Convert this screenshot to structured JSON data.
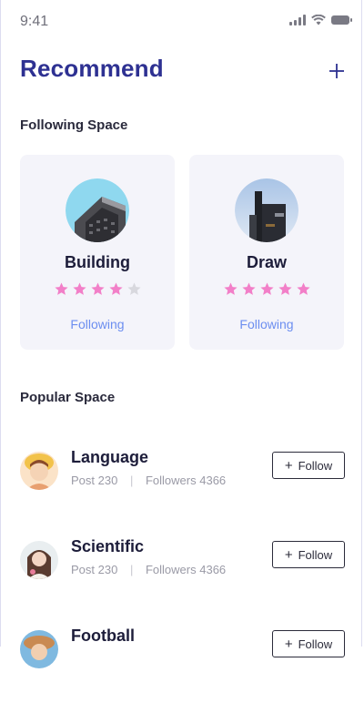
{
  "status_bar": {
    "time": "9:41",
    "icons": [
      "cellular-signal-icon",
      "wifi-icon",
      "battery-icon"
    ]
  },
  "header": {
    "title": "Recommend",
    "add_icon": "plus-icon"
  },
  "following_section": {
    "title": "Following Space",
    "cards": [
      {
        "name": "Building",
        "rating": 4,
        "max_rating": 5,
        "action": "Following"
      },
      {
        "name": "Draw",
        "rating": 5,
        "max_rating": 5,
        "action": "Following"
      }
    ]
  },
  "popular_section": {
    "title": "Popular Space",
    "post_label": "Post",
    "followers_label": "Followers",
    "follow_label": "Follow",
    "items": [
      {
        "name": "Language",
        "posts": "230",
        "followers": "4366"
      },
      {
        "name": "Scientific",
        "posts": "230",
        "followers": "4366"
      },
      {
        "name": "Football",
        "posts": "",
        "followers": ""
      }
    ]
  },
  "colors": {
    "title": "#2e3192",
    "link": "#6c8ef0",
    "star_filled": "#f27fc8",
    "star_empty": "#d8d8de",
    "card_bg": "#f4f4fa"
  }
}
